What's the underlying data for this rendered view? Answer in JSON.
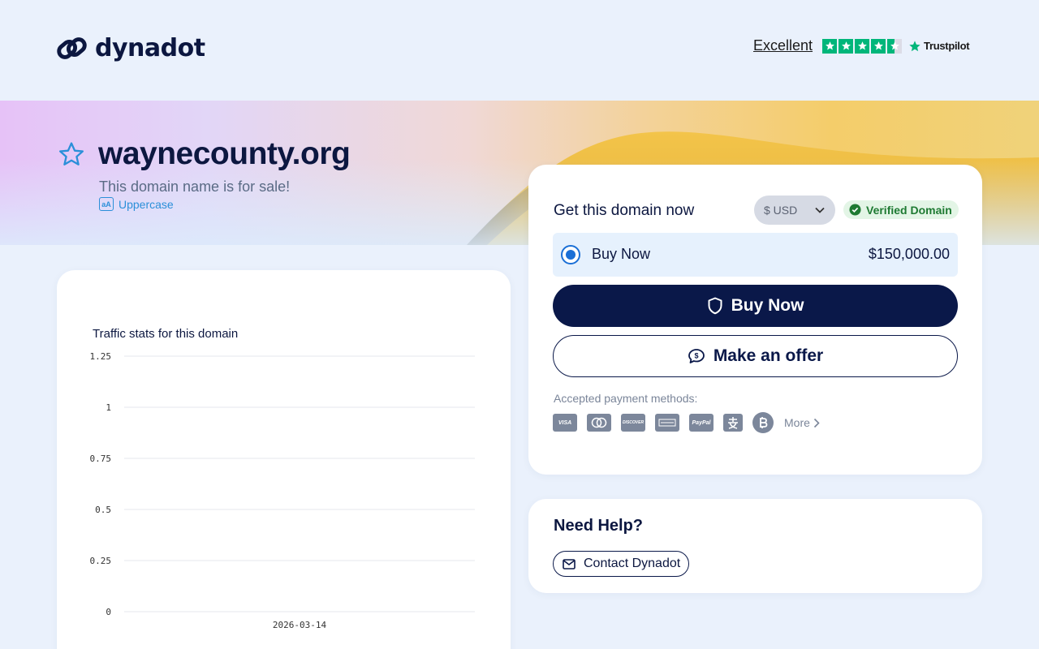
{
  "header": {
    "brand": "dynadot",
    "trustpilot": {
      "rating_label": "Excellent",
      "stars": 4.5,
      "brand": "Trustpilot",
      "accent": "#00b67a"
    }
  },
  "hero": {
    "domain": "waynecounty.org",
    "subtitle": "This domain name is for sale!",
    "case_toggle": "Uppercase"
  },
  "purchase": {
    "title": "Get this domain now",
    "currency": "$ USD",
    "verified": "Verified Domain",
    "option": {
      "label": "Buy Now",
      "price": "$150,000.00",
      "selected": true
    },
    "buy_button": "Buy Now",
    "offer_button": "Make an offer",
    "payment_label": "Accepted payment methods:",
    "payment_methods": [
      "visa-icon",
      "mastercard-icon",
      "discover-icon",
      "amex-icon",
      "paypal-icon",
      "alipay-icon",
      "bitcoin-icon"
    ],
    "more": "More"
  },
  "help": {
    "title": "Need Help?",
    "contact": "Contact Dynadot"
  },
  "chart_data": {
    "type": "line",
    "title": "Traffic stats for this domain",
    "x": [
      "2026-03-14"
    ],
    "yticks": [
      "1.25",
      "1",
      "0.75",
      "0.5",
      "0.25",
      "0"
    ],
    "ylim": [
      0,
      1.25
    ],
    "series": [
      {
        "values": [
          0
        ]
      }
    ],
    "grid": true
  },
  "colors": {
    "navy": "#0a1849",
    "accent_blue": "#1a6fd6",
    "verified_green": "#1e7a32"
  }
}
